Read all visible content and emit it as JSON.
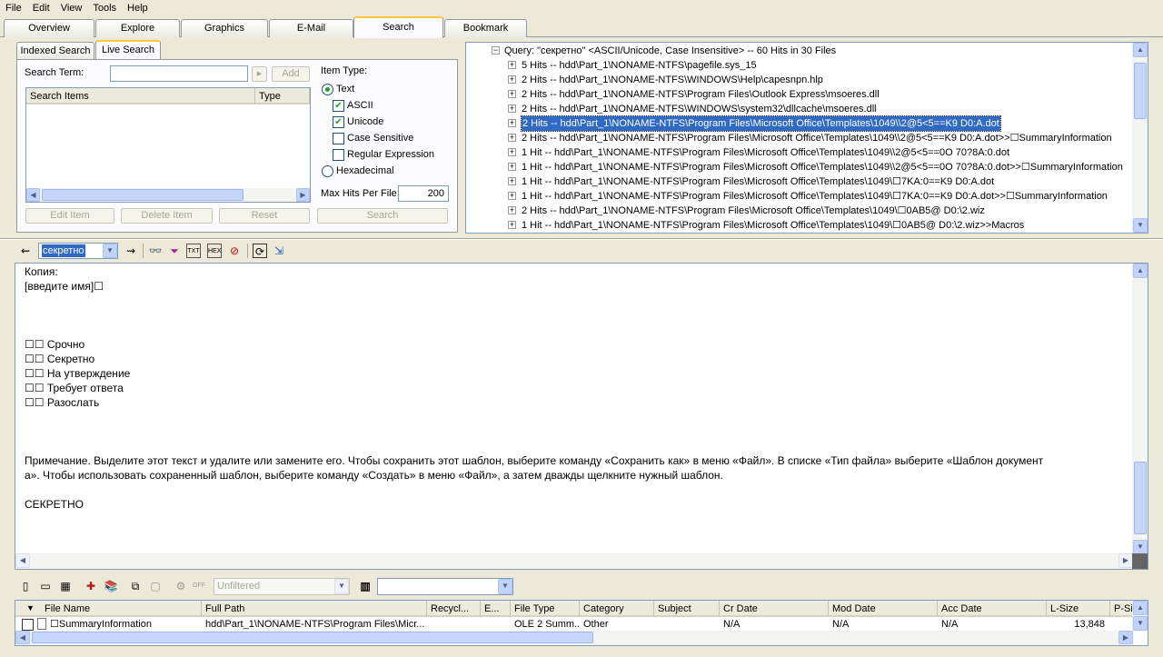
{
  "menu": [
    "File",
    "Edit",
    "View",
    "Tools",
    "Help"
  ],
  "main_tabs": [
    "Overview",
    "Explore",
    "Graphics",
    "E-Mail",
    "Search",
    "Bookmark"
  ],
  "active_tab": "Search",
  "search_subtabs": [
    "Indexed Search",
    "Live Search"
  ],
  "live_search": {
    "search_term_label": "Search Term:",
    "search_term_value": "",
    "add_button": "Add",
    "items_header": [
      "Search Items",
      "Type"
    ],
    "item_type_label": "Item Type:",
    "text_option": "Text",
    "ascii_option": "ASCII",
    "unicode_option": "Unicode",
    "case_sensitive_option": "Case Sensitive",
    "regex_option": "Regular Expression",
    "hex_option": "Hexadecimal",
    "max_hits_label": "Max Hits Per File:",
    "max_hits_value": "200",
    "edit_item": "Edit Item",
    "delete_item": "Delete Item",
    "reset": "Reset",
    "search": "Search"
  },
  "results_tree": {
    "query": "Query: \"секретно\" <ASCII/Unicode, Case Insensitive> -- 60 Hits in 30 Files",
    "rows": [
      "5 Hits -- hdd\\Part_1\\NONAME-NTFS\\pagefile.sys_15",
      "2 Hits -- hdd\\Part_1\\NONAME-NTFS\\WINDOWS\\Help\\capesnpn.hlp",
      "2 Hits -- hdd\\Part_1\\NONAME-NTFS\\Program Files\\Outlook Express\\msoeres.dll",
      "2 Hits -- hdd\\Part_1\\NONAME-NTFS\\WINDOWS\\system32\\dllcache\\msoeres.dll",
      "2 Hits -- hdd\\Part_1\\NONAME-NTFS\\Program Files\\Microsoft Office\\Templates\\1049\\\\2@5<5==K9 D0:A.dot",
      "2 Hits -- hdd\\Part_1\\NONAME-NTFS\\Program Files\\Microsoft Office\\Templates\\1049\\\\2@5<5==K9 D0:A.dot>>☐SummaryInformation",
      "1 Hit -- hdd\\Part_1\\NONAME-NTFS\\Program Files\\Microsoft Office\\Templates\\1049\\\\2@5<5==0O 70?8A:0.dot",
      "1 Hit -- hdd\\Part_1\\NONAME-NTFS\\Program Files\\Microsoft Office\\Templates\\1049\\\\2@5<5==0O 70?8A:0.dot>>☐SummaryInformation",
      "1 Hit -- hdd\\Part_1\\NONAME-NTFS\\Program Files\\Microsoft Office\\Templates\\1049\\☐7KA:0==K9 D0:A.dot",
      "1 Hit -- hdd\\Part_1\\NONAME-NTFS\\Program Files\\Microsoft Office\\Templates\\1049\\☐7KA:0==K9 D0:A.dot>>☐SummaryInformation",
      "2 Hits -- hdd\\Part_1\\NONAME-NTFS\\Program Files\\Microsoft Office\\Templates\\1049\\☐0AB5@ D0:\\2.wiz",
      "1 Hit -- hdd\\Part_1\\NONAME-NTFS\\Program Files\\Microsoft Office\\Templates\\1049\\☐0AB5@ D0:\\2.wiz>>Macros"
    ],
    "selected_index": 4
  },
  "viewer_toolbar": {
    "search_combo": "секретно"
  },
  "viewer_lines": [
    "Копия:",
    "[введите имя]☐",
    "",
    "",
    "",
    "☐☐ Срочно",
    "☐☐ Секретно",
    "☐☐ На утверждение",
    "☐☐ Требует ответа",
    "☐☐ Разослать",
    "",
    "",
    "",
    "Примечание. Выделите этот текст и удалите или замените его. Чтобы сохранить этот шаблон, выберите команду «Сохранить как» в меню «Файл». В списке «Тип файла» выберите «Шаблон документ",
    "а». Чтобы использовать сохраненный шаблон, выберите команду «Создать» в меню «Файл», а затем дважды щелкните нужный шаблон.",
    "",
    "СЕКРЕТНО"
  ],
  "filter_toolbar": {
    "filter_state": "OFF",
    "filter_value": "Unfiltered",
    "column_combo": ""
  },
  "file_table": {
    "columns": [
      "File Name",
      "Full Path",
      "Recycl...",
      "E...",
      "File Type",
      "Category",
      "Subject",
      "Cr Date",
      "Mod Date",
      "Acc Date",
      "L-Size",
      "P-Siz"
    ],
    "rows": [
      [
        "☐SummaryInformation",
        "hdd\\Part_1\\NONAME-NTFS\\Program Files\\Micr...",
        "",
        "",
        "OLE 2 Summ...",
        "Other",
        "",
        "N/A",
        "N/A",
        "N/A",
        "13,848",
        ""
      ]
    ]
  }
}
